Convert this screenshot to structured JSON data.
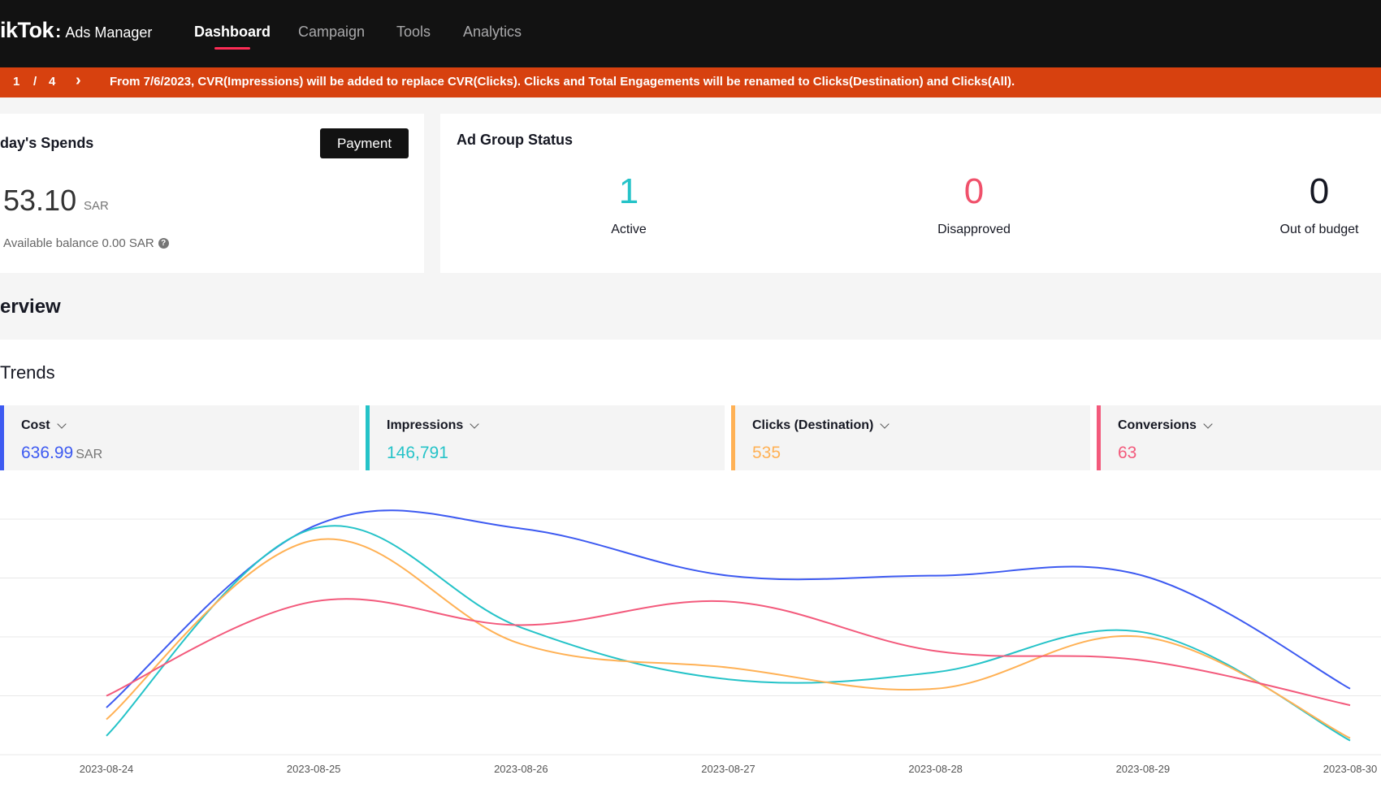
{
  "nav": {
    "brand": "ikTok",
    "brand_colon": ":",
    "product": "Ads Manager",
    "tabs": [
      {
        "label": "Dashboard",
        "active": true
      },
      {
        "label": "Campaign",
        "active": false
      },
      {
        "label": "Tools",
        "active": false
      },
      {
        "label": "Analytics",
        "active": false
      }
    ]
  },
  "banner": {
    "page_current": "1",
    "page_sep": "/",
    "page_total": "4",
    "next_arrow": "›",
    "message": "From 7/6/2023, CVR(Impressions) will be added to replace CVR(Clicks). Clicks and Total Engagements will be renamed to Clicks(Destination) and Clicks(All)."
  },
  "spends": {
    "title": "day's Spends",
    "payment_label": "Payment",
    "amount": "53.10",
    "currency": "SAR",
    "balance_text": "Available balance 0.00 SAR"
  },
  "ad_group_status": {
    "title": "Ad Group Status",
    "stats": [
      {
        "value": "1",
        "label": "Active",
        "color": "#25c3c8"
      },
      {
        "value": "0",
        "label": "Disapproved",
        "color": "#fe2c55"
      },
      {
        "value": "0",
        "label": "Out of budget",
        "color": "#161823"
      }
    ]
  },
  "overview": {
    "title": "erview"
  },
  "trends": {
    "title": "Trends",
    "metrics": [
      {
        "name": "Cost",
        "value": "636.99",
        "unit": "SAR",
        "color": "#3d5af1"
      },
      {
        "name": "Impressions",
        "value": "146,791",
        "unit": "",
        "color": "#25c3c8"
      },
      {
        "name": "Clicks (Destination)",
        "value": "535",
        "unit": "",
        "color": "#ffb155"
      },
      {
        "name": "Conversions",
        "value": "63",
        "unit": "",
        "color": "#f35a7c"
      }
    ]
  },
  "chart_data": {
    "type": "line",
    "x": [
      "2023-08-24",
      "2023-08-25",
      "2023-08-26",
      "2023-08-27",
      "2023-08-28",
      "2023-08-29",
      "2023-08-30"
    ],
    "grid": true,
    "normalized": true,
    "series": [
      {
        "name": "Cost",
        "color": "#3d5af1",
        "values": [
          0.2,
          0.97,
          0.96,
          0.76,
          0.76,
          0.76,
          0.28
        ]
      },
      {
        "name": "Impressions",
        "color": "#25c3c8",
        "values": [
          0.08,
          0.96,
          0.54,
          0.32,
          0.35,
          0.52,
          0.06
        ]
      },
      {
        "name": "Clicks (Destination)",
        "color": "#ffb155",
        "values": [
          0.15,
          0.91,
          0.47,
          0.37,
          0.28,
          0.5,
          0.07
        ]
      },
      {
        "name": "Conversions",
        "color": "#f35a7c",
        "values": [
          0.25,
          0.65,
          0.55,
          0.65,
          0.44,
          0.4,
          0.21
        ]
      }
    ]
  }
}
